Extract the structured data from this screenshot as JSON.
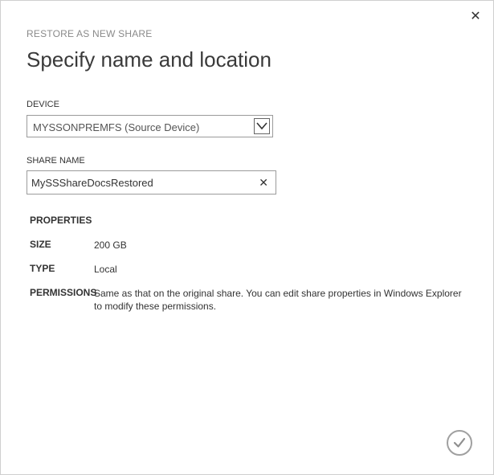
{
  "dialog": {
    "eyebrow": "RESTORE AS NEW SHARE",
    "title": "Specify name and location",
    "close_glyph": "✕"
  },
  "device": {
    "label": "DEVICE",
    "selected": "MYSSONPREMFS (Source Device)"
  },
  "share": {
    "label": "SHARE NAME",
    "value": "MySSShareDocsRestored",
    "clear_glyph": "✕"
  },
  "properties": {
    "heading": "PROPERTIES",
    "size_key": "SIZE",
    "size_value": "200 GB",
    "type_key": "TYPE",
    "type_value": "Local",
    "permissions_key": "PERMISSIONS",
    "permissions_value": "Same as that on the original share. You can edit share properties in Windows Explorer to modify these permissions."
  },
  "icons": {
    "close": "close-icon",
    "dropdown": "chevron-down-icon",
    "clear": "clear-icon",
    "confirm": "checkmark-icon"
  },
  "colors": {
    "eyebrow": "#8a8a8a",
    "border": "#9b9b9b",
    "confirm_ring": "#a0a0a0"
  }
}
